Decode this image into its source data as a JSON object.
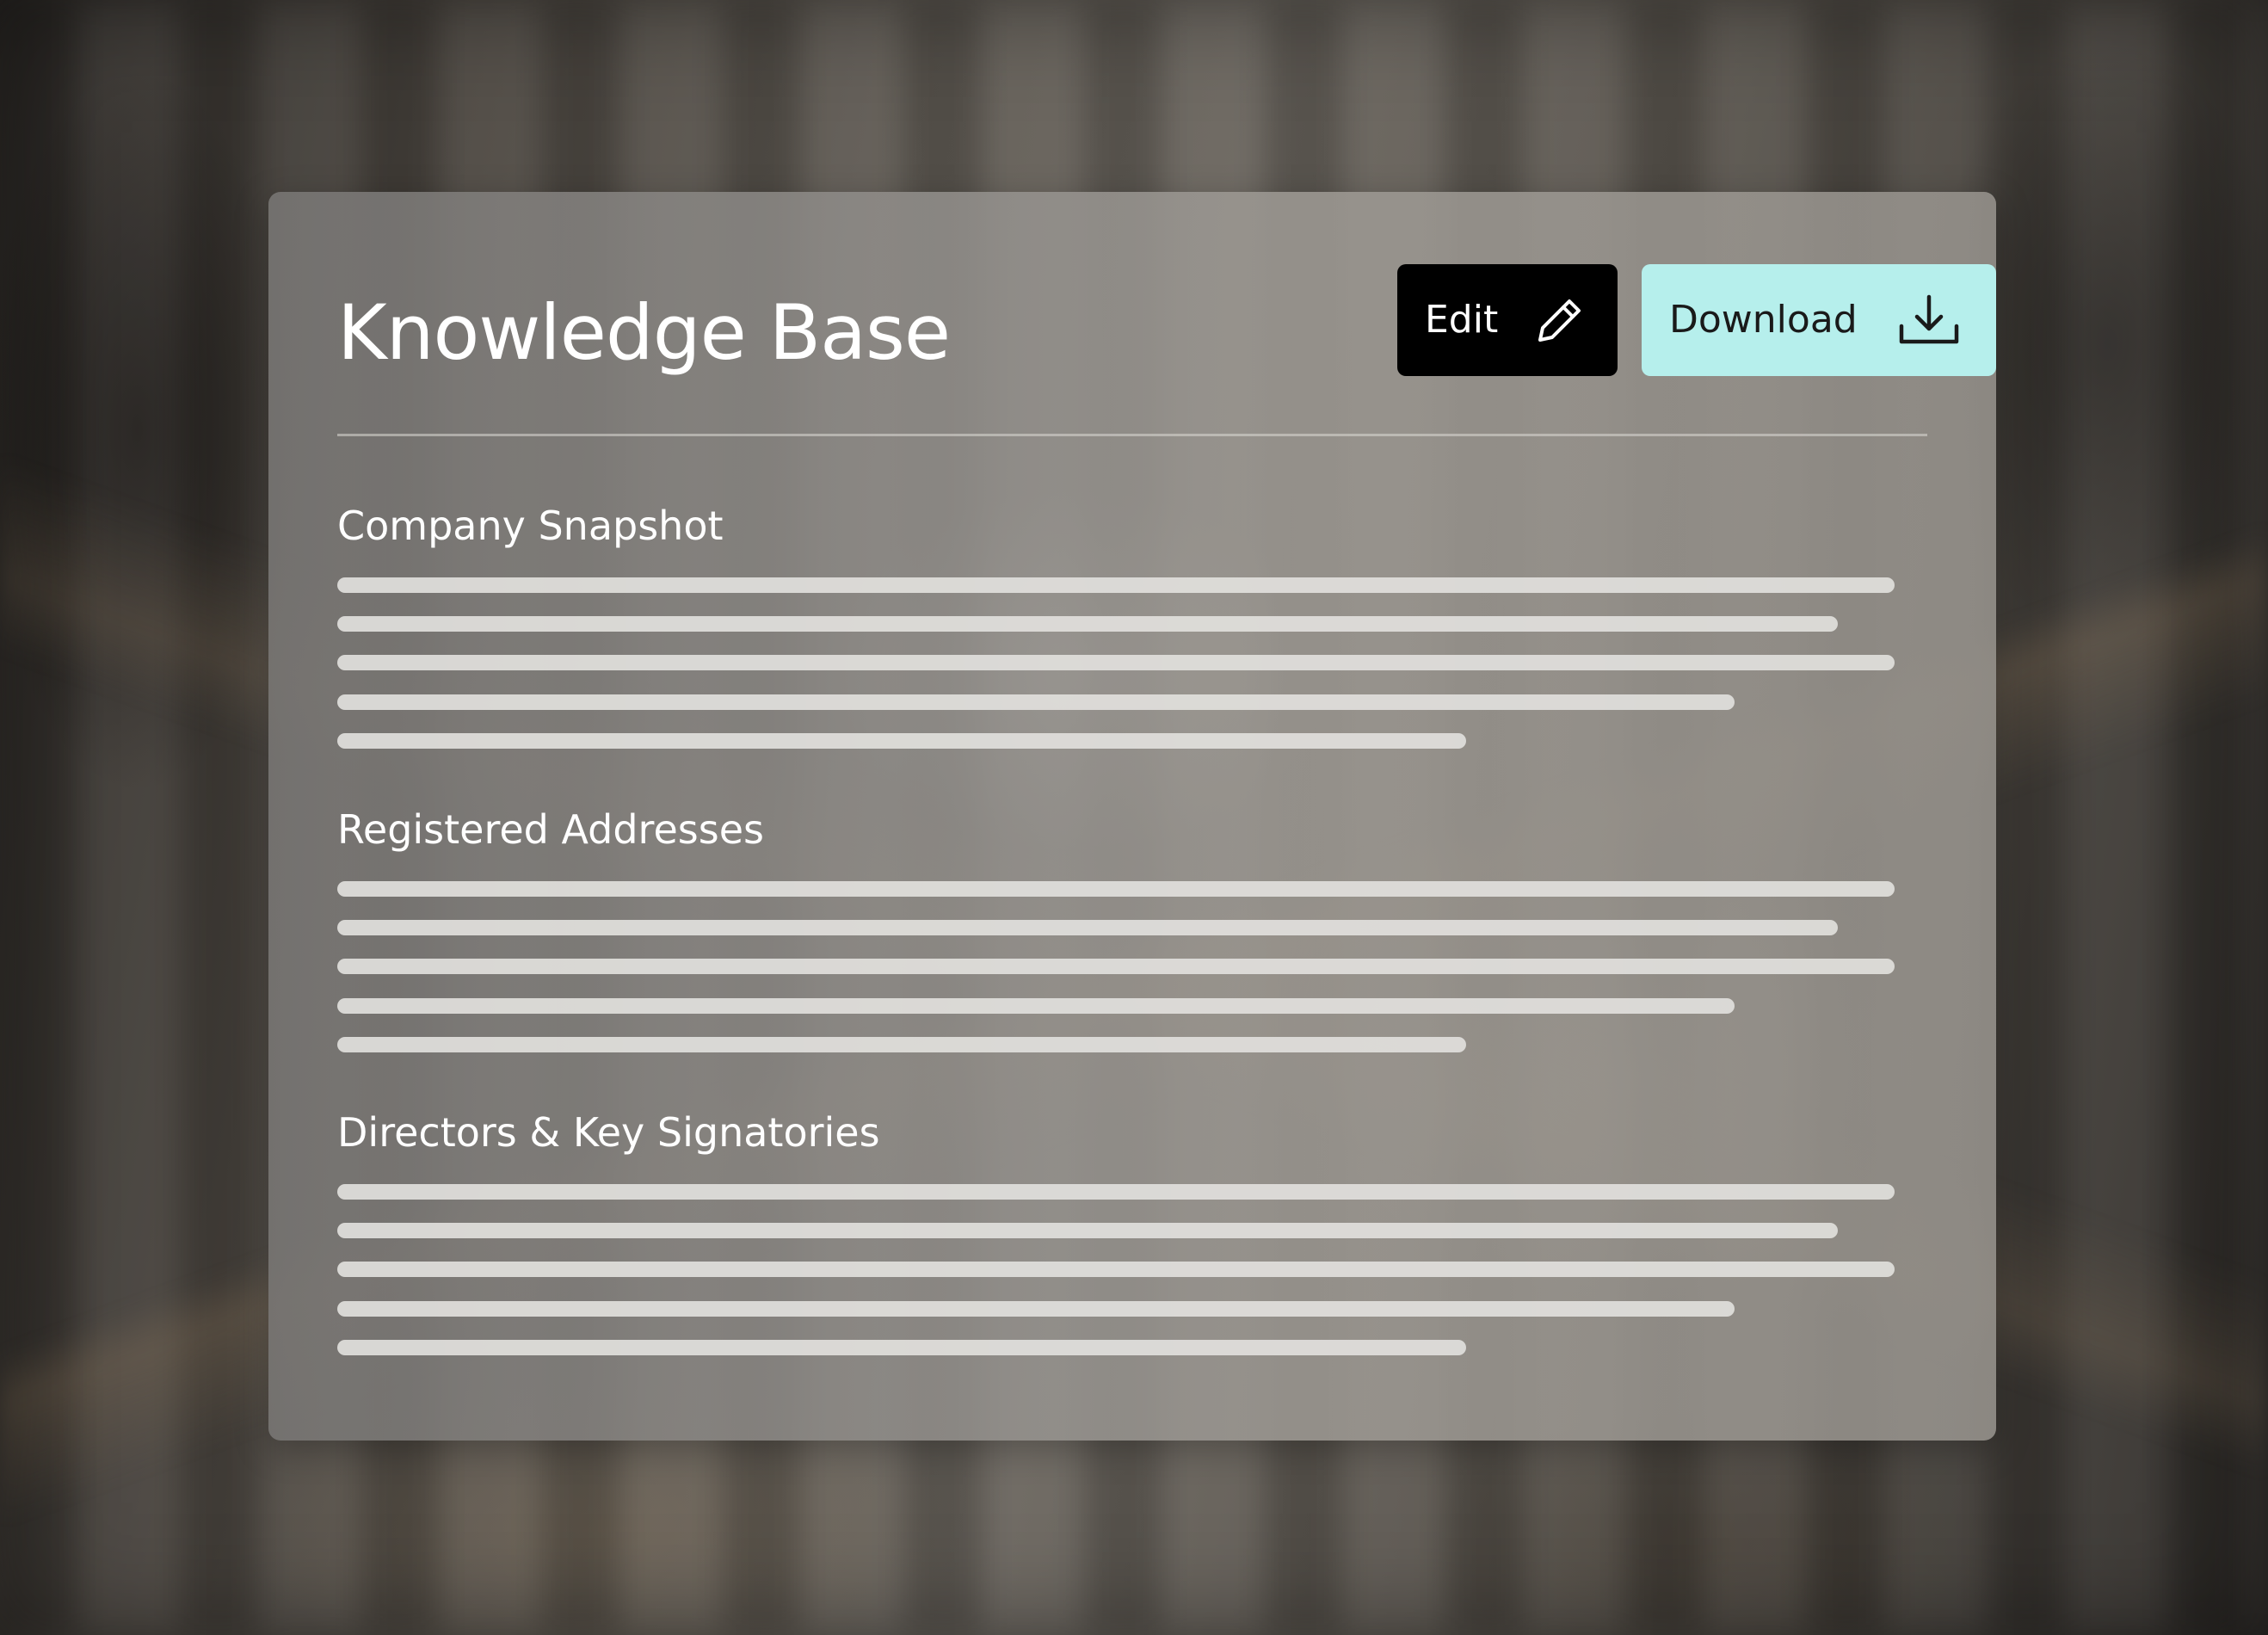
{
  "page": {
    "title": "Knowledge Base"
  },
  "actions": {
    "edit_label": "Edit",
    "edit_icon": "pencil-icon",
    "download_label": "Download",
    "download_icon": "download-icon"
  },
  "sections": [
    {
      "title": "Company Snapshot"
    },
    {
      "title": "Registered Addresses"
    },
    {
      "title": "Directors & Key Signatories"
    }
  ],
  "colors": {
    "edit_button_bg": "#000000",
    "download_button_bg": "#b6efec",
    "title_text": "#ffffff"
  }
}
